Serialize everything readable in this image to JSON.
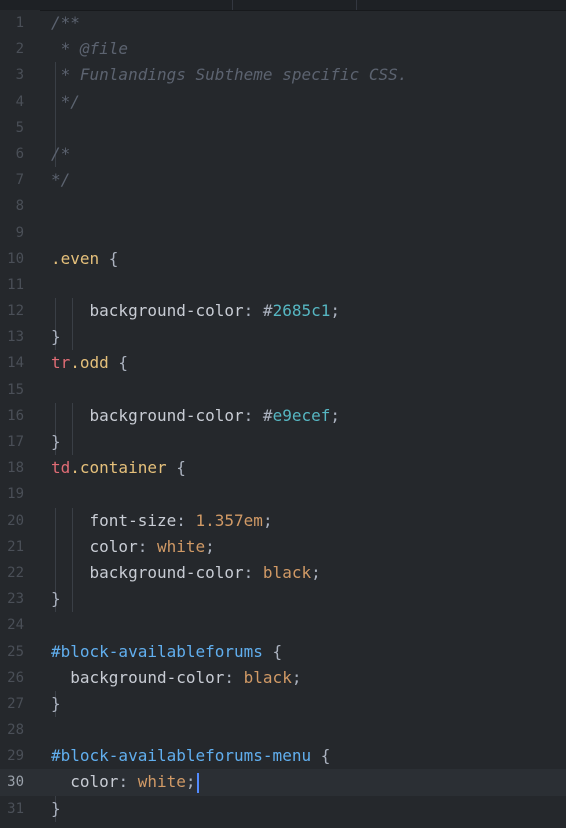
{
  "editor": {
    "lines": [
      {
        "n": "1",
        "tokens": [
          {
            "t": "/**",
            "c": "comment"
          }
        ]
      },
      {
        "n": "2",
        "tokens": [
          {
            "t": " * @file",
            "c": "comment"
          }
        ]
      },
      {
        "n": "3",
        "tokens": [
          {
            "t": " * Funlandings Subtheme specific CSS.",
            "c": "comment"
          }
        ]
      },
      {
        "n": "4",
        "tokens": [
          {
            "t": " */",
            "c": "comment"
          }
        ]
      },
      {
        "n": "5",
        "tokens": []
      },
      {
        "n": "6",
        "tokens": [
          {
            "t": "/*",
            "c": "comment"
          }
        ]
      },
      {
        "n": "7",
        "tokens": [
          {
            "t": "*/",
            "c": "comment"
          }
        ]
      },
      {
        "n": "8",
        "tokens": []
      },
      {
        "n": "9",
        "tokens": []
      },
      {
        "n": "10",
        "tokens": [
          {
            "t": ".even",
            "c": "class"
          },
          {
            "t": " {",
            "c": "punc"
          }
        ]
      },
      {
        "n": "11",
        "tokens": []
      },
      {
        "n": "12",
        "tokens": [
          {
            "t": "    background-color",
            "c": "prop"
          },
          {
            "t": ": ",
            "c": "punc"
          },
          {
            "t": "#",
            "c": "punc"
          },
          {
            "t": "2685c1",
            "c": "hex"
          },
          {
            "t": ";",
            "c": "punc"
          }
        ]
      },
      {
        "n": "13",
        "tokens": [
          {
            "t": "}",
            "c": "punc"
          }
        ]
      },
      {
        "n": "14",
        "tokens": [
          {
            "t": "tr",
            "c": "tag"
          },
          {
            "t": ".odd",
            "c": "class"
          },
          {
            "t": " {",
            "c": "punc"
          }
        ]
      },
      {
        "n": "15",
        "tokens": []
      },
      {
        "n": "16",
        "tokens": [
          {
            "t": "    background-color",
            "c": "prop"
          },
          {
            "t": ": ",
            "c": "punc"
          },
          {
            "t": "#",
            "c": "punc"
          },
          {
            "t": "e9ecef",
            "c": "hex"
          },
          {
            "t": ";",
            "c": "punc"
          }
        ]
      },
      {
        "n": "17",
        "tokens": [
          {
            "t": "}",
            "c": "punc"
          }
        ]
      },
      {
        "n": "18",
        "tokens": [
          {
            "t": "td",
            "c": "tag"
          },
          {
            "t": ".container",
            "c": "class"
          },
          {
            "t": " {",
            "c": "punc"
          }
        ]
      },
      {
        "n": "19",
        "tokens": []
      },
      {
        "n": "20",
        "tokens": [
          {
            "t": "    font-size",
            "c": "prop"
          },
          {
            "t": ": ",
            "c": "punc"
          },
          {
            "t": "1.357em",
            "c": "num"
          },
          {
            "t": ";",
            "c": "punc"
          }
        ]
      },
      {
        "n": "21",
        "tokens": [
          {
            "t": "    color",
            "c": "prop"
          },
          {
            "t": ": ",
            "c": "punc"
          },
          {
            "t": "white",
            "c": "val"
          },
          {
            "t": ";",
            "c": "punc"
          }
        ]
      },
      {
        "n": "22",
        "tokens": [
          {
            "t": "    background-color",
            "c": "prop"
          },
          {
            "t": ": ",
            "c": "punc"
          },
          {
            "t": "black",
            "c": "val"
          },
          {
            "t": ";",
            "c": "punc"
          }
        ]
      },
      {
        "n": "23",
        "tokens": [
          {
            "t": "}",
            "c": "punc"
          }
        ]
      },
      {
        "n": "24",
        "tokens": []
      },
      {
        "n": "25",
        "tokens": [
          {
            "t": "#block-availableforums",
            "c": "id"
          },
          {
            "t": " {",
            "c": "punc"
          }
        ]
      },
      {
        "n": "26",
        "tokens": [
          {
            "t": "  background-color",
            "c": "prop"
          },
          {
            "t": ": ",
            "c": "punc"
          },
          {
            "t": "black",
            "c": "val"
          },
          {
            "t": ";",
            "c": "punc"
          }
        ]
      },
      {
        "n": "27",
        "tokens": [
          {
            "t": "}",
            "c": "punc"
          }
        ]
      },
      {
        "n": "28",
        "tokens": []
      },
      {
        "n": "29",
        "tokens": [
          {
            "t": "#block-availableforums-menu",
            "c": "id"
          },
          {
            "t": " {",
            "c": "punc"
          }
        ]
      },
      {
        "n": "30",
        "tokens": [
          {
            "t": "  color",
            "c": "prop"
          },
          {
            "t": ": ",
            "c": "punc"
          },
          {
            "t": "white",
            "c": "val"
          },
          {
            "t": ";",
            "c": "punc"
          }
        ],
        "cursor": true
      },
      {
        "n": "31",
        "tokens": [
          {
            "t": "}",
            "c": "punc"
          }
        ]
      }
    ]
  },
  "theme": {
    "background": "#25282c",
    "comment": "#5c6370",
    "selector_class": "#e5c07b",
    "selector_tag": "#e06c75",
    "selector_id": "#61afef",
    "number": "#d19a66",
    "hex_color": "#56b6c2",
    "cursor": "#528bff"
  }
}
